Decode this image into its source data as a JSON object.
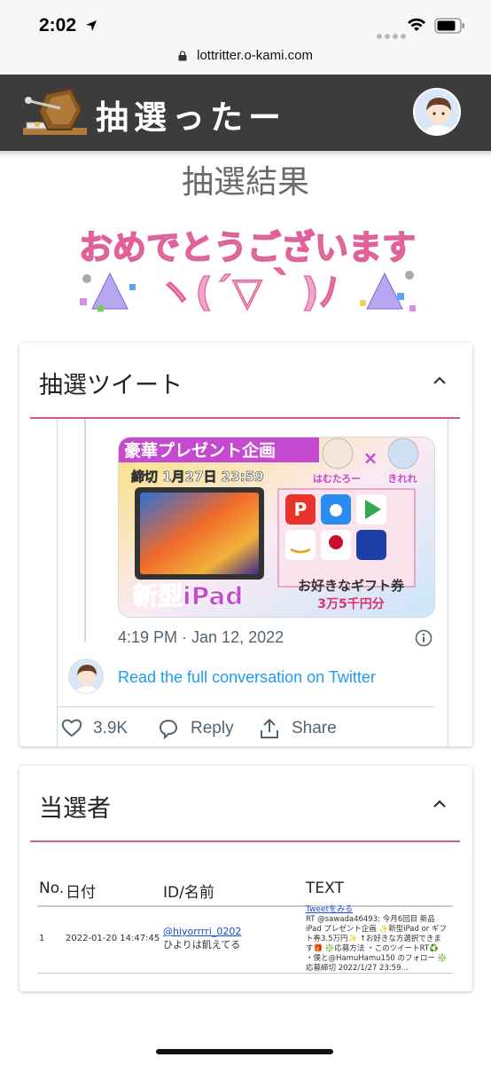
{
  "status_bar": {
    "time": "2:02"
  },
  "browser": {
    "url": "lottritter.o-kami.com"
  },
  "header": {
    "brand": "抽選ったー"
  },
  "page": {
    "title": "抽選結果",
    "congrats_text": "おめでとうございます"
  },
  "tweet_card": {
    "title": "抽選ツイート",
    "image_texts": {
      "banner": "豪華プレゼント企画",
      "deadline": "締切 1月27日 23:59",
      "host1": "はむたろー",
      "times": "×",
      "host2": "きれれ",
      "product": "新型iPad",
      "gift": "お好きなギフト券",
      "amount": "3万5千円分"
    },
    "timestamp": "4:19 PM · Jan 12, 2022",
    "read_link": "Read the full conversation on Twitter",
    "likes": "3.9K",
    "reply_label": "Reply",
    "share_label": "Share"
  },
  "winners_card": {
    "title": "当選者",
    "columns": [
      "No.",
      "日付",
      "ID/名前",
      "TEXT"
    ],
    "rows": [
      {
        "no": "1",
        "date": "2022-01-20 14:47:45",
        "handle": "@hiyorrrri_0202",
        "name": "ひよりは飢えてる",
        "tweet_link": "Tweetをみる",
        "text": "RT @sawada46493: 今月6回目 新品iPad プレゼント企画 ✨新型iPad or ギフト券3.5万円✨ ↑お好きな方選択できます🎁 ❇️応募方法 ・このツイートRT♻️ ・僕と@HamuHamu150 のフォロー ❇️応募締切 2022/1/27 23:59…"
      }
    ]
  },
  "colors": {
    "header_bg": "#3c3c3c",
    "accent_rule": "#d6588a",
    "twitter_blue": "#1d9bf0",
    "title_gray": "#6a6a6a"
  }
}
